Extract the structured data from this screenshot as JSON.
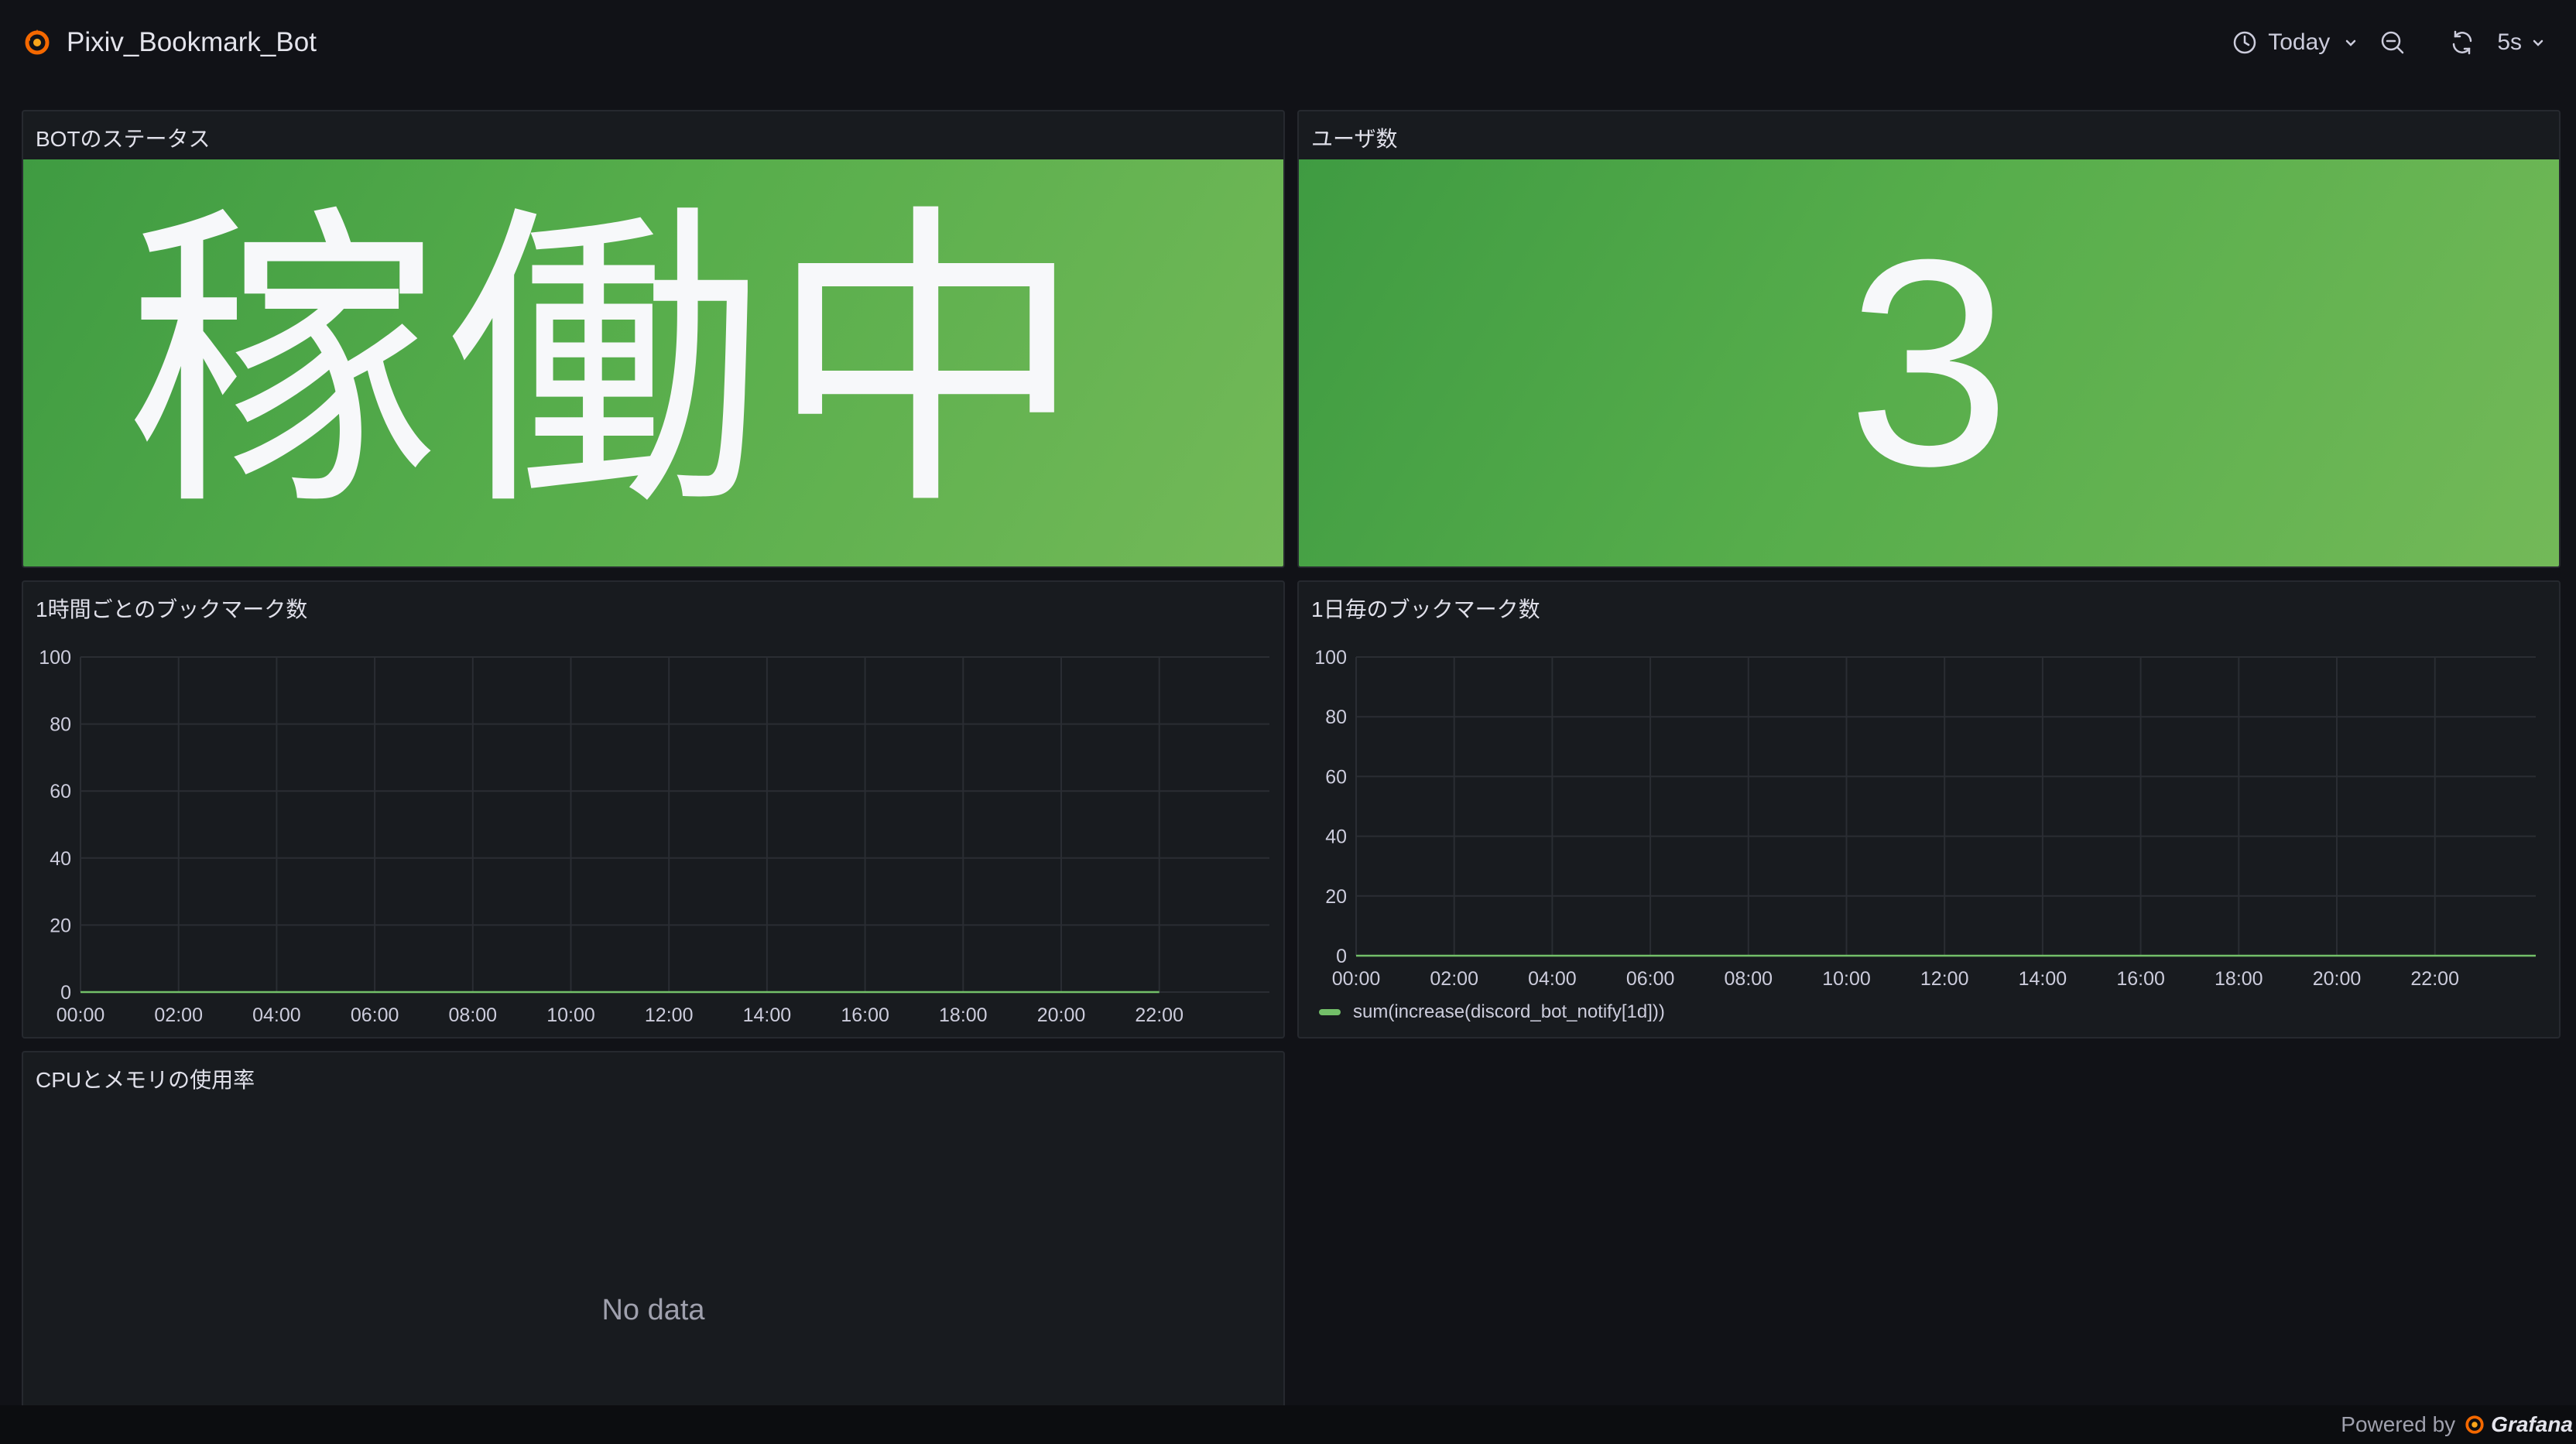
{
  "header": {
    "title": "Pixiv_Bookmark_Bot",
    "time_range": "Today",
    "refresh_interval": "5s",
    "icons": [
      "grafana-logo-icon",
      "clock-icon",
      "chevron-down-icon",
      "zoom-out-icon",
      "refresh-icon",
      "chevron-down-icon"
    ]
  },
  "panels": {
    "bot_status": {
      "title": "BOTのステータス",
      "value": "稼働中",
      "color": "#56ad4b"
    },
    "user_count": {
      "title": "ユーザ数",
      "value": "3",
      "color": "#56ad4b"
    },
    "hourly": {
      "title": "1時間ごとのブックマーク数"
    },
    "daily": {
      "title": "1日毎のブックマーク数",
      "legend": "sum(increase(discord_bot_notify[1d]))"
    },
    "cpu_mem": {
      "title": "CPUとメモリの使用率",
      "no_data": "No data"
    }
  },
  "footer": {
    "powered_by": "Powered by",
    "brand": "Grafana"
  },
  "chart_data": [
    {
      "type": "line",
      "title": "1時間ごとのブックマーク数",
      "x": [
        "00:00",
        "02:00",
        "04:00",
        "06:00",
        "08:00",
        "10:00",
        "12:00",
        "14:00",
        "16:00",
        "18:00",
        "20:00",
        "22:00"
      ],
      "ylim": [
        0,
        100
      ],
      "yticks": [
        0,
        20,
        40,
        60,
        80,
        100
      ],
      "series": [
        {
          "values": [
            0,
            0,
            0,
            0,
            0,
            0,
            0,
            0,
            0,
            0,
            0,
            0
          ],
          "color": "#73bf69"
        }
      ],
      "grid": true
    },
    {
      "type": "line",
      "title": "1日毎のブックマーク数",
      "x": [
        "00:00",
        "02:00",
        "04:00",
        "06:00",
        "08:00",
        "10:00",
        "12:00",
        "14:00",
        "16:00",
        "18:00",
        "20:00",
        "22:00"
      ],
      "ylim": [
        0,
        100
      ],
      "yticks": [
        0,
        20,
        40,
        60,
        80,
        100
      ],
      "series": [
        {
          "name": "sum(increase(discord_bot_notify[1d]))",
          "values": [
            0,
            0,
            0,
            0,
            0,
            0,
            0,
            0,
            0,
            0,
            0,
            0
          ],
          "color": "#73bf69"
        }
      ],
      "grid": true,
      "legend": "bottom-left"
    }
  ]
}
